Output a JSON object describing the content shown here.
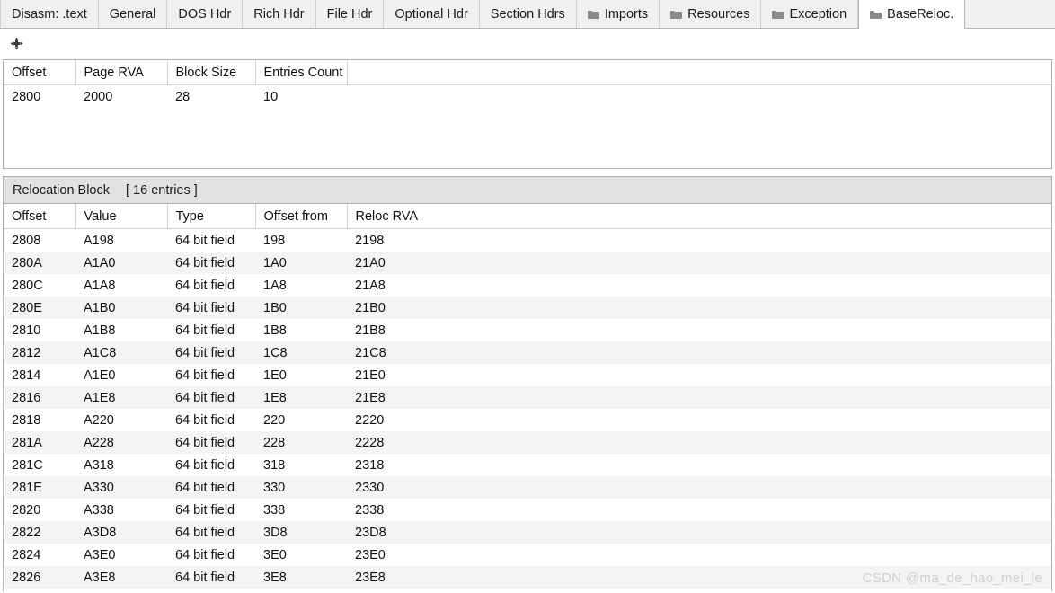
{
  "tabs": [
    {
      "label": "Disasm: .text",
      "icon": null,
      "selected": false
    },
    {
      "label": "General",
      "icon": null,
      "selected": false
    },
    {
      "label": "DOS Hdr",
      "icon": null,
      "selected": false
    },
    {
      "label": "Rich Hdr",
      "icon": null,
      "selected": false
    },
    {
      "label": "File Hdr",
      "icon": null,
      "selected": false
    },
    {
      "label": "Optional Hdr",
      "icon": null,
      "selected": false
    },
    {
      "label": "Section Hdrs",
      "icon": null,
      "selected": false
    },
    {
      "label": "Imports",
      "icon": "folder-icon",
      "selected": false
    },
    {
      "label": "Resources",
      "icon": "folder-icon",
      "selected": false
    },
    {
      "label": "Exception",
      "icon": "folder-icon",
      "selected": false
    },
    {
      "label": "BaseReloc.",
      "icon": "folder-icon",
      "selected": true
    }
  ],
  "toolbar": {
    "move_icon": "move-icon"
  },
  "directory_table": {
    "columns": [
      "Offset",
      "Page RVA",
      "Block Size",
      "Entries Count"
    ],
    "rows": [
      {
        "offset": "2800",
        "page_rva": "2000",
        "block_size": "28",
        "entries_count": "10"
      }
    ]
  },
  "relocation_block": {
    "title": "Relocation Block",
    "entries_label": "[ 16 entries ]",
    "columns": [
      "Offset",
      "Value",
      "Type",
      "Offset from",
      "Reloc RVA"
    ],
    "rows": [
      {
        "offset": "2808",
        "value": "A198",
        "type": "64 bit field",
        "offset_from": "198",
        "reloc_rva": "2198"
      },
      {
        "offset": "280A",
        "value": "A1A0",
        "type": "64 bit field",
        "offset_from": "1A0",
        "reloc_rva": "21A0"
      },
      {
        "offset": "280C",
        "value": "A1A8",
        "type": "64 bit field",
        "offset_from": "1A8",
        "reloc_rva": "21A8"
      },
      {
        "offset": "280E",
        "value": "A1B0",
        "type": "64 bit field",
        "offset_from": "1B0",
        "reloc_rva": "21B0"
      },
      {
        "offset": "2810",
        "value": "A1B8",
        "type": "64 bit field",
        "offset_from": "1B8",
        "reloc_rva": "21B8"
      },
      {
        "offset": "2812",
        "value": "A1C8",
        "type": "64 bit field",
        "offset_from": "1C8",
        "reloc_rva": "21C8"
      },
      {
        "offset": "2814",
        "value": "A1E0",
        "type": "64 bit field",
        "offset_from": "1E0",
        "reloc_rva": "21E0"
      },
      {
        "offset": "2816",
        "value": "A1E8",
        "type": "64 bit field",
        "offset_from": "1E8",
        "reloc_rva": "21E8"
      },
      {
        "offset": "2818",
        "value": "A220",
        "type": "64 bit field",
        "offset_from": "220",
        "reloc_rva": "2220"
      },
      {
        "offset": "281A",
        "value": "A228",
        "type": "64 bit field",
        "offset_from": "228",
        "reloc_rva": "2228"
      },
      {
        "offset": "281C",
        "value": "A318",
        "type": "64 bit field",
        "offset_from": "318",
        "reloc_rva": "2318"
      },
      {
        "offset": "281E",
        "value": "A330",
        "type": "64 bit field",
        "offset_from": "330",
        "reloc_rva": "2330"
      },
      {
        "offset": "2820",
        "value": "A338",
        "type": "64 bit field",
        "offset_from": "338",
        "reloc_rva": "2338"
      },
      {
        "offset": "2822",
        "value": "A3D8",
        "type": "64 bit field",
        "offset_from": "3D8",
        "reloc_rva": "23D8"
      },
      {
        "offset": "2824",
        "value": "A3E0",
        "type": "64 bit field",
        "offset_from": "3E0",
        "reloc_rva": "23E0"
      },
      {
        "offset": "2826",
        "value": "A3E8",
        "type": "64 bit field",
        "offset_from": "3E8",
        "reloc_rva": "23E8"
      }
    ]
  },
  "watermark": {
    "text": "CSDN @ma_de_hao_mei_le"
  },
  "colors": {
    "offset_green": "#159b2e",
    "rva_blue": "#2020d8",
    "row_alt": "#f4f4f4",
    "panel_header": "#e2e2e2",
    "tabbar_bg": "#f0f0f0"
  }
}
